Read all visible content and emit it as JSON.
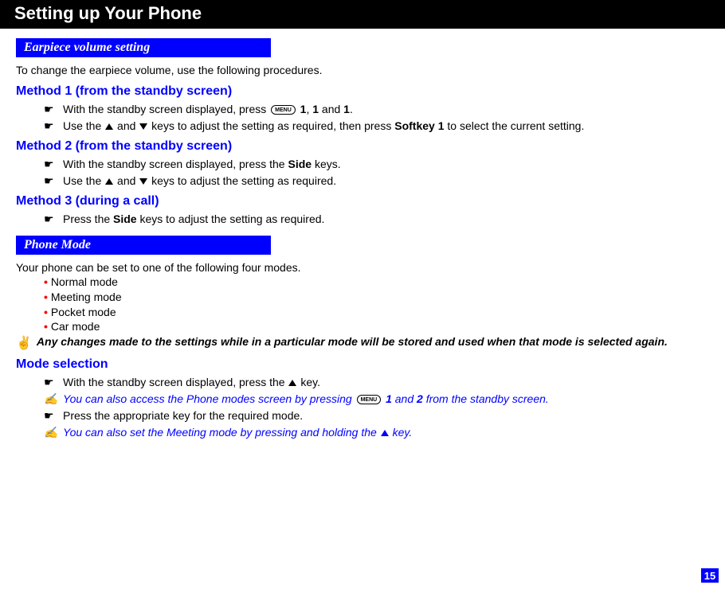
{
  "titlebar": "Setting up Your Phone",
  "section1": {
    "header": "Earpiece volume setting",
    "intro": "To change the earpiece volume, use the following procedures.",
    "method1": {
      "heading": "Method 1 (from the standby screen)",
      "s1a": "With the standby screen displayed, press ",
      "s1b": " 1",
      "s1c": ", ",
      "s1d": "1",
      "s1e": " and ",
      "s1f": "1",
      "s1g": ".",
      "s2a": "Use the ",
      "s2b": " and ",
      "s2c": " keys to adjust the setting as required, then press ",
      "s2d": "Softkey 1",
      "s2e": " to select the current setting."
    },
    "method2": {
      "heading": "Method 2 (from the standby screen)",
      "s1a": "With the standby screen displayed, press the ",
      "s1b": "Side",
      "s1c": " keys.",
      "s2a": "Use the ",
      "s2b": " and ",
      "s2c": " keys to adjust the setting as required."
    },
    "method3": {
      "heading": "Method 3 (during a call)",
      "s1a": "Press the ",
      "s1b": "Side",
      "s1c": " keys to adjust the setting as required."
    }
  },
  "section2": {
    "header": "Phone Mode",
    "intro": "Your phone can be set to one of the following four modes.",
    "modes": {
      "m1": "Normal mode",
      "m2": "Meeting mode",
      "m3": "Pocket mode",
      "m4": "Car mode"
    },
    "note": "Any changes made to the settings while in a particular mode will be stored and used when that mode is selected again.",
    "modesel": {
      "heading": "Mode selection",
      "s1a": "With the standby screen displayed, press the ",
      "s1b": " key.",
      "n1a": "You can also access the Phone modes screen by pressing ",
      "n1b": " 1",
      "n1c": " and ",
      "n1d": "2",
      "n1e": " from the standby screen.",
      "s2": "Press the appropriate key for the required mode.",
      "n2a": "You can also set the Meeting mode by pressing and holding the ",
      "n2b": " key."
    }
  },
  "menutext": "MENU",
  "pagenum": "15"
}
